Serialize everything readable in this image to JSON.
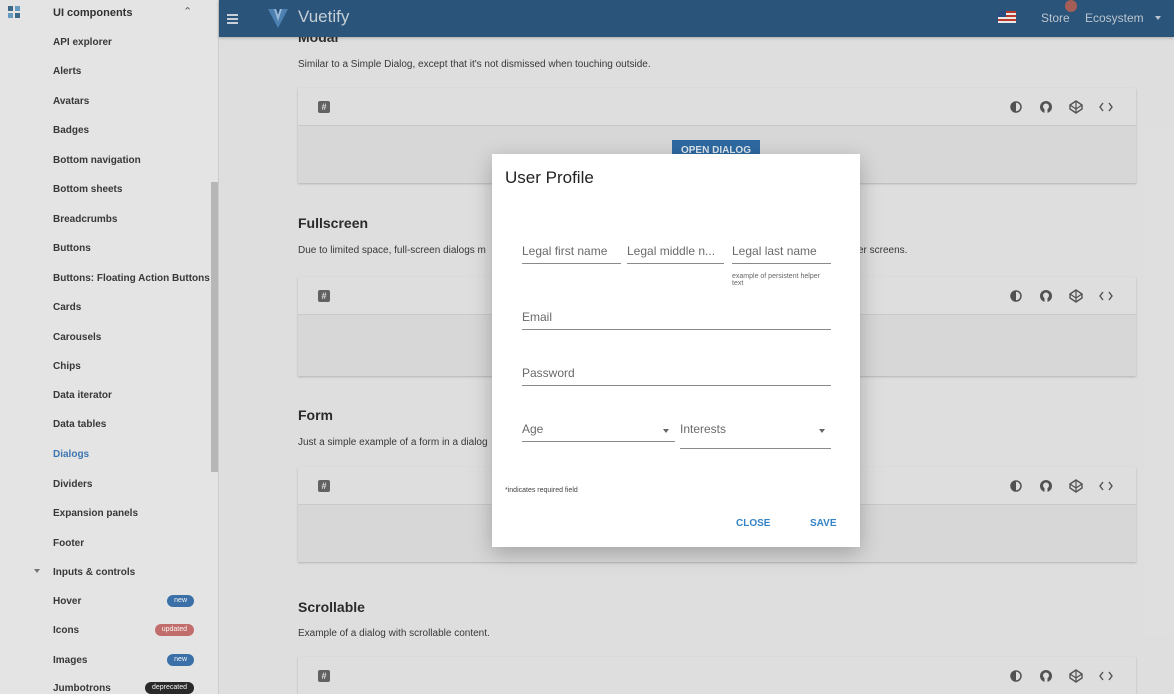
{
  "sidebar": {
    "group_label": "UI components",
    "items": [
      {
        "label": "API explorer"
      },
      {
        "label": "Alerts"
      },
      {
        "label": "Avatars"
      },
      {
        "label": "Badges"
      },
      {
        "label": "Bottom navigation"
      },
      {
        "label": "Bottom sheets"
      },
      {
        "label": "Breadcrumbs"
      },
      {
        "label": "Buttons"
      },
      {
        "label": "Buttons: Floating Action Buttons"
      },
      {
        "label": "Cards"
      },
      {
        "label": "Carousels"
      },
      {
        "label": "Chips"
      },
      {
        "label": "Data iterator"
      },
      {
        "label": "Data tables"
      },
      {
        "label": "Dialogs"
      },
      {
        "label": "Dividers"
      },
      {
        "label": "Expansion panels"
      },
      {
        "label": "Footer"
      }
    ],
    "subgroup_label": "Inputs & controls",
    "sub_items": [
      {
        "label": "Hover",
        "badge": "new",
        "badge_color": "#3c73ad"
      },
      {
        "label": "Icons",
        "badge": "updated",
        "badge_color": "#c8716f"
      },
      {
        "label": "Images",
        "badge": "new",
        "badge_color": "#3c73ad"
      },
      {
        "label": "Jumbotrons",
        "badge": "deprecated",
        "badge_color": "#2b2b2b"
      }
    ],
    "active_item": "Dialogs",
    "accent_color": "#3f7ab6"
  },
  "appbar": {
    "brand": "Vuetify",
    "store_label": "Store",
    "ecosystem_label": "Ecosystem",
    "bg_color": "#2c577e"
  },
  "main": {
    "modal_heading": "Modal",
    "modal_desc": "Similar to a Simple Dialog, except that it's not dismissed when touching outside.",
    "open_dialog_label": "OPEN DIALOG",
    "fullscreen_title": "Fullscreen",
    "fullscreen_desc": "Due to limited space, full-screen dialogs m",
    "fullscreen_desc_tail": "er screens.",
    "form_title": "Form",
    "form_desc": "Just a simple example of a form in a dialog",
    "scrollable_title": "Scrollable",
    "scrollable_desc": "Example of a dialog with scrollable content.",
    "hash_glyph": "#"
  },
  "dialog": {
    "title": "User Profile",
    "first_name_label": "Legal first name",
    "middle_name_label": "Legal middle n...",
    "last_name_label": "Legal last name",
    "last_name_helper": "example of persistent helper text",
    "email_label": "Email",
    "password_label": "Password",
    "age_label": "Age",
    "interests_label": "Interests",
    "required_note": "*indicates required field",
    "close_label": "CLOSE",
    "save_label": "SAVE"
  }
}
